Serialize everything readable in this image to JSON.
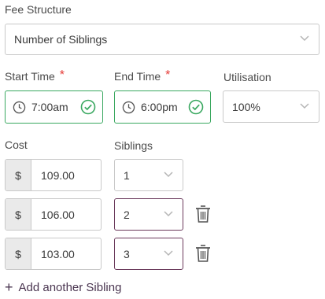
{
  "fee_structure": {
    "label": "Fee Structure",
    "selected": "Number of Siblings"
  },
  "start_time": {
    "label": "Start Time",
    "required_mark": "*",
    "value": "7:00am"
  },
  "end_time": {
    "label": "End Time",
    "required_mark": "*",
    "value": "6:00pm"
  },
  "utilisation": {
    "label": "Utilisation",
    "selected": "100%"
  },
  "cost_label": "Cost",
  "siblings_label": "Siblings",
  "currency_symbol": "$",
  "rows": [
    {
      "cost": "109.00",
      "siblings": "1"
    },
    {
      "cost": "106.00",
      "siblings": "2"
    },
    {
      "cost": "103.00",
      "siblings": "3"
    }
  ],
  "add_label": "Add another Sibling",
  "add_icon": "+",
  "colors": {
    "valid": "#3aa860",
    "required": "#e53935",
    "accent": "#6b3a5c"
  }
}
